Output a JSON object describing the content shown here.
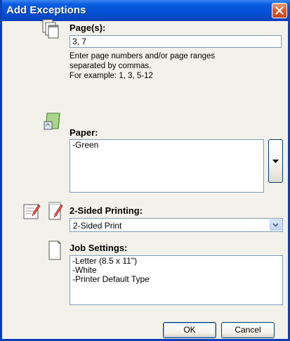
{
  "window": {
    "title": "Add Exceptions"
  },
  "pages": {
    "label": "Page(s):",
    "value": "3, 7",
    "help_lines": [
      "Enter page numbers and/or page ranges",
      "separated by commas.",
      "For example: 1, 3, 5-12"
    ]
  },
  "paper": {
    "label": "Paper:",
    "value": "-Green"
  },
  "two_sided": {
    "label": "2-Sided Printing:",
    "selected": "2-Sided Print"
  },
  "job_settings": {
    "label": "Job Settings:",
    "lines": [
      "-Letter (8.5 x 11\")",
      "-White",
      "-Printer Default Type"
    ]
  },
  "buttons": {
    "ok": "OK",
    "cancel": "Cancel"
  },
  "icons": {
    "close": "close-icon",
    "pages": "pages-icon",
    "paper": "paper-icon",
    "two_sided_a": "two-sided-icon",
    "two_sided_b": "two-sided-alt-icon",
    "job_settings": "document-icon",
    "dropdown": "chevron-down-icon"
  },
  "colors": {
    "titlebar": "#0351d6",
    "close": "#e35b2b",
    "dialog_bg": "#f3f2ea"
  }
}
